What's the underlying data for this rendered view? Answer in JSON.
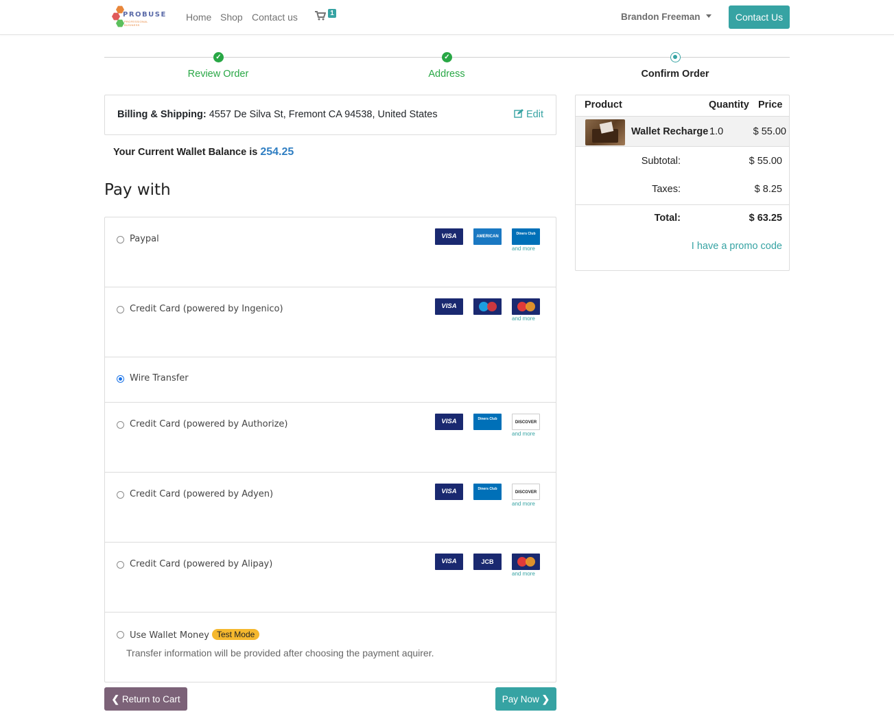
{
  "header": {
    "logo_text": "PROBUSE",
    "logo_sub": "PROFESSIONAL BUSINESS",
    "nav": [
      "Home",
      "Shop",
      "Contact us"
    ],
    "cart_count": "1",
    "user_name": "Brandon Freeman",
    "contact_button": "Contact Us"
  },
  "steps": [
    {
      "label": "Review Order",
      "state": "done"
    },
    {
      "label": "Address",
      "state": "done"
    },
    {
      "label": "Confirm Order",
      "state": "active"
    }
  ],
  "billing": {
    "label": "Billing & Shipping:",
    "address": "4557 De Silva St, Fremont CA 94538, United States",
    "edit_label": "Edit"
  },
  "wallet": {
    "label": "Your Current Wallet Balance is",
    "balance": "254.25"
  },
  "pay_with_title": "Pay with",
  "payment_methods": [
    {
      "label": "Paypal",
      "checked": false,
      "cards": [
        "VISA",
        "AMERICAN EXPRESS",
        "Diners Club"
      ],
      "and_more": "and more"
    },
    {
      "label": "Credit Card (powered by Ingenico)",
      "checked": false,
      "cards": [
        "VISA",
        "Maestro",
        "MasterCard"
      ],
      "and_more": "and more"
    },
    {
      "label": "Wire Transfer",
      "checked": true
    },
    {
      "label": "Credit Card (powered by Authorize)",
      "checked": false,
      "cards": [
        "VISA",
        "Diners Club",
        "DISCOVER"
      ],
      "and_more": "and more"
    },
    {
      "label": "Credit Card (powered by Adyen)",
      "checked": false,
      "cards": [
        "VISA",
        "Diners Club",
        "DISCOVER"
      ],
      "and_more": "and more"
    },
    {
      "label": "Credit Card (powered by Alipay)",
      "checked": false,
      "cards": [
        "VISA",
        "JCB",
        "MasterCard"
      ],
      "and_more": "and more"
    },
    {
      "label": "Use Wallet Money",
      "checked": false,
      "badge": "Test Mode",
      "note": "Transfer information will be provided after choosing the payment aquirer."
    }
  ],
  "buttons": {
    "return": "Return to Cart",
    "pay": "Pay Now"
  },
  "summary": {
    "headers": {
      "product": "Product",
      "quantity": "Quantity",
      "price": "Price"
    },
    "item": {
      "name": "Wallet Recharge",
      "quantity": "1.0",
      "price": "$ 55.00"
    },
    "subtotal_label": "Subtotal:",
    "subtotal": "$ 55.00",
    "taxes_label": "Taxes:",
    "taxes": "$ 8.25",
    "total_label": "Total:",
    "total": "$ 63.25",
    "promo": "I have a promo code"
  },
  "colors": {
    "accent": "#36a3a3",
    "success": "#28a745",
    "return_button": "#7c6278",
    "wallet_value": "#2f7ec2",
    "badge": "#f5b82e"
  }
}
